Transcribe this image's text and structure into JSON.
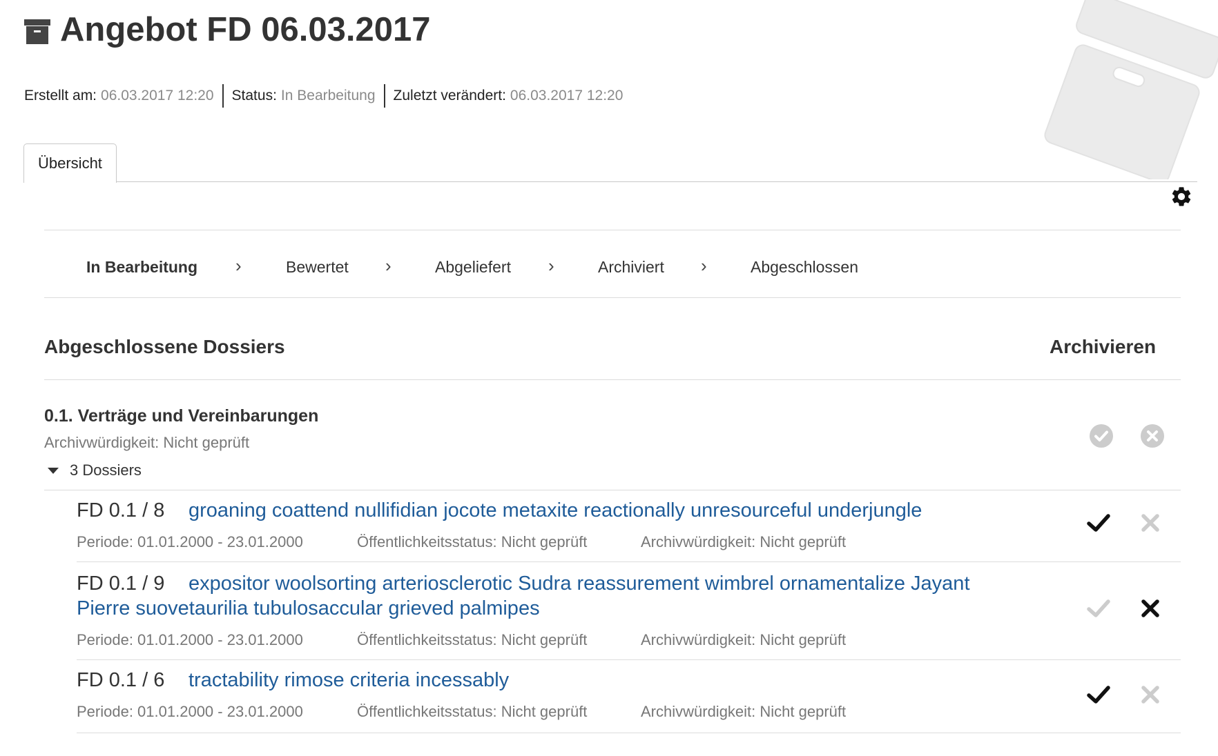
{
  "header": {
    "title": "Angebot FD 06.03.2017",
    "created_label": "Erstellt am:",
    "created_value": "06.03.2017 12:20",
    "status_label": "Status:",
    "status_value": "In Bearbeitung",
    "modified_label": "Zuletzt verändert:",
    "modified_value": "06.03.2017 12:20"
  },
  "tabs": [
    {
      "label": "Übersicht"
    }
  ],
  "workflow": {
    "steps": [
      "In Bearbeitung",
      "Bewertet",
      "Abgeliefert",
      "Archiviert",
      "Abgeschlossen"
    ],
    "active": "In Bearbeitung",
    "separator": "›"
  },
  "section": {
    "title": "Abgeschlossene Dossiers",
    "right_heading": "Archivieren"
  },
  "group": {
    "title": "0.1. Verträge und Vereinbarungen",
    "subtitle": "Archivwürdigkeit: Nicht geprüft",
    "toggle_label": "3 Dossiers"
  },
  "dossiers": [
    {
      "ref": "FD 0.1 / 8",
      "title": "groaning coattend nullifidian jocote metaxite reactionally unresourceful underjungle",
      "period": "Periode: 01.01.2000 - 23.01.2000",
      "public_status": "Öffentlichkeitsstatus: Nicht geprüft",
      "archival": "Archivwürdigkeit: Nicht geprüft",
      "decision": "archive"
    },
    {
      "ref": "FD 0.1 / 9",
      "title_line1": "expositor woolsorting arteriosclerotic Sudra reassurement wimbrel ornamentalize Jayant",
      "title_line2": "Pierre suovetaurilia tubulosaccular grieved palmipes",
      "period": "Periode: 01.01.2000 - 23.01.2000",
      "public_status": "Öffentlichkeitsstatus: Nicht geprüft",
      "archival": "Archivwürdigkeit: Nicht geprüft",
      "decision": "discard"
    },
    {
      "ref": "FD 0.1 / 6",
      "title": "tractability rimose criteria incessably",
      "period": "Periode: 01.01.2000 - 23.01.2000",
      "public_status": "Öffentlichkeitsstatus: Nicht geprüft",
      "archival": "Archivwürdigkeit: Nicht geprüft",
      "decision": "archive"
    }
  ],
  "colors": {
    "link": "#1f5c99",
    "muted": "#777777",
    "inactive_icon": "#cccccc",
    "active_icon": "#111111",
    "meta_value": "#8a8a8a"
  },
  "icons": {
    "title": "archive-box-icon",
    "settings": "gear-icon",
    "archive": "checkmark-icon",
    "discard": "x-icon"
  }
}
